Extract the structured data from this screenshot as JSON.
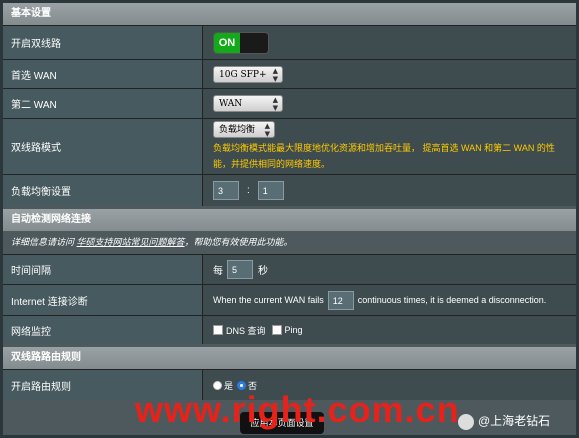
{
  "basic": {
    "header": "基本设置",
    "rows": {
      "dual_wan": {
        "label": "开启双线路",
        "toggle_on": "ON"
      },
      "primary_wan": {
        "label": "首选 WAN",
        "value": "10G SFP+"
      },
      "secondary_wan": {
        "label": "第二 WAN",
        "value": "WAN"
      },
      "mode": {
        "label": "双线路模式",
        "value": "负载均衡",
        "desc_line1": "负载均衡模式能最大限度地优化资源和增加吞吐量， 提高首选 WAN 和第二 WAN 的性",
        "desc_line2": "能，并提供相同的网络速度。"
      },
      "lb": {
        "label": "负载均衡设置",
        "ratio_a": "3",
        "sep": ":",
        "ratio_b": "1"
      }
    }
  },
  "auto_detect": {
    "header": "自动检测网络连接",
    "note_prefix": "详细信息请访问 ",
    "note_link": "华硕支持网站常见问题解答",
    "note_suffix": "，帮助您有效使用此功能。",
    "rows": {
      "interval": {
        "label": "时间间隔",
        "prefix": "每",
        "value": "5",
        "unit": "秒"
      },
      "internet": {
        "label": "Internet 连接诊断",
        "prefix": "When the current WAN fails",
        "value": "12",
        "suffix": "continuous times, it is deemed a disconnection."
      },
      "monitor": {
        "label": "网络监控",
        "opt1": "DNS 查询",
        "opt2": "Ping"
      }
    }
  },
  "routing": {
    "header": "双线路路由规则",
    "rows": {
      "enable": {
        "label": "开启路由规则",
        "yes": "是",
        "no": "否"
      }
    }
  },
  "apply_button": "应用本页面设置",
  "watermark": "www.right.com.cn",
  "weibo": "@上海老钻石"
}
